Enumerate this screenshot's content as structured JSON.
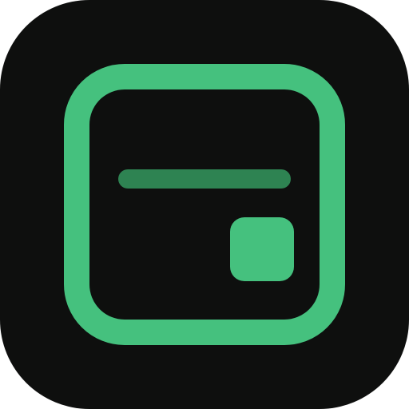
{
  "app_icon": {
    "semantic_name": "app-icon",
    "glyph": "rounded-square-with-bar-and-small-square",
    "background_color": "#0e0f0e",
    "outline_color": "#45c17e",
    "bar_color": "#2e8352",
    "square_color": "#45c17e"
  }
}
